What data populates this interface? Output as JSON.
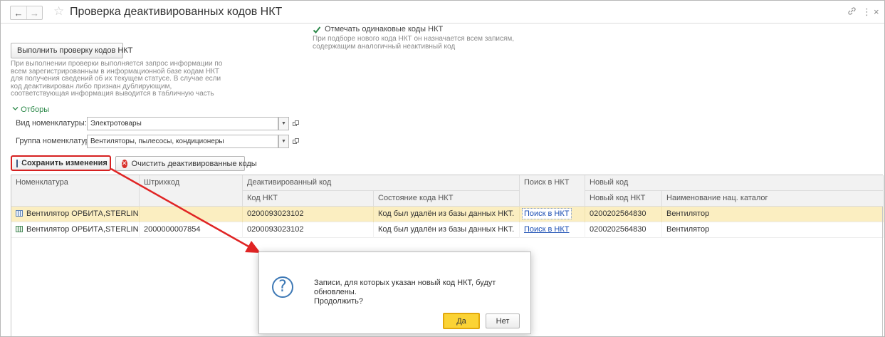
{
  "window": {
    "title": "Проверка деактивированных кодов НКТ",
    "back_glyph": "←",
    "forward_glyph": "→",
    "star_glyph": "☆",
    "link_glyph": "🔗",
    "more_glyph": "⋮",
    "close_glyph": "×"
  },
  "check_button": {
    "label": "Выполнить проверку кодов НКТ"
  },
  "check_description": [
    "При выполнении проверки выполняется запрос информации по",
    "всем зарегистрированным в информационной базе кодам НКТ",
    "для получения сведений об их текущем статусе. В случае если",
    "код деактивирован либо признан дублирующим,",
    "соответствующая информация выводится в табличную часть"
  ],
  "same_codes_option": {
    "label": "Отмечать одинаковые коды НКТ",
    "checked": true,
    "description": [
      "При подборе нового кода НКТ он назначается всем записям,",
      "содержащим аналогичный неактивный код"
    ]
  },
  "filters": {
    "toggle_label": "Отборы",
    "nomenclature_type": {
      "label": "Вид номенклатуры:",
      "value": "Электротовары"
    },
    "nomenclature_group": {
      "label": "Группа номенклатуры:",
      "value": "Вентиляторы, пылесосы, кондиционеры"
    }
  },
  "toolbar": {
    "save_label": "Сохранить изменения",
    "clear_label": "Очистить деактивированные коды"
  },
  "table": {
    "headers": {
      "nomenclature": "Номенклатура",
      "barcode": "Штрихкод",
      "deactivated_group": "Деактивированный код",
      "code_nkt": "Код НКТ",
      "code_state": "Состояние кода НКТ",
      "search_nkt": "Поиск в НКТ",
      "new_code_group": "Новый код",
      "new_code_nkt": "Новый код НКТ",
      "national_catalog_name": "Наименование нац. каталог"
    },
    "rows": [
      {
        "nomenclature": "Вентилятор ОРБИТА,STERLIN...",
        "barcode": "",
        "code_nkt": "0200093023102",
        "code_state": "Код был удалён из базы данных НКТ.",
        "search_nkt": "Поиск в НКТ",
        "new_code_nkt": "0200202564830",
        "national_catalog_name": "Вентилятор",
        "selected": true
      },
      {
        "nomenclature": "Вентилятор ОРБИТА,STERLIN...",
        "barcode": "2000000007854",
        "code_nkt": "0200093023102",
        "code_state": "Код был удалён из базы данных НКТ.",
        "search_nkt": "Поиск в НКТ",
        "new_code_nkt": "0200202564830",
        "national_catalog_name": "Вентилятор",
        "selected": false
      }
    ]
  },
  "dialog": {
    "icon_glyph": "?",
    "message_line1": "Записи, для которых указан новый код НКТ, будут обновлены.",
    "message_line2": "Продолжить?",
    "yes_label": "Да",
    "no_label": "Нет"
  },
  "colors": {
    "accent_green": "#2e8a4b",
    "highlight_red": "#d62020",
    "selected_row": "#fbeec1",
    "primary_button": "#fbd335",
    "link": "#1a4db3"
  }
}
